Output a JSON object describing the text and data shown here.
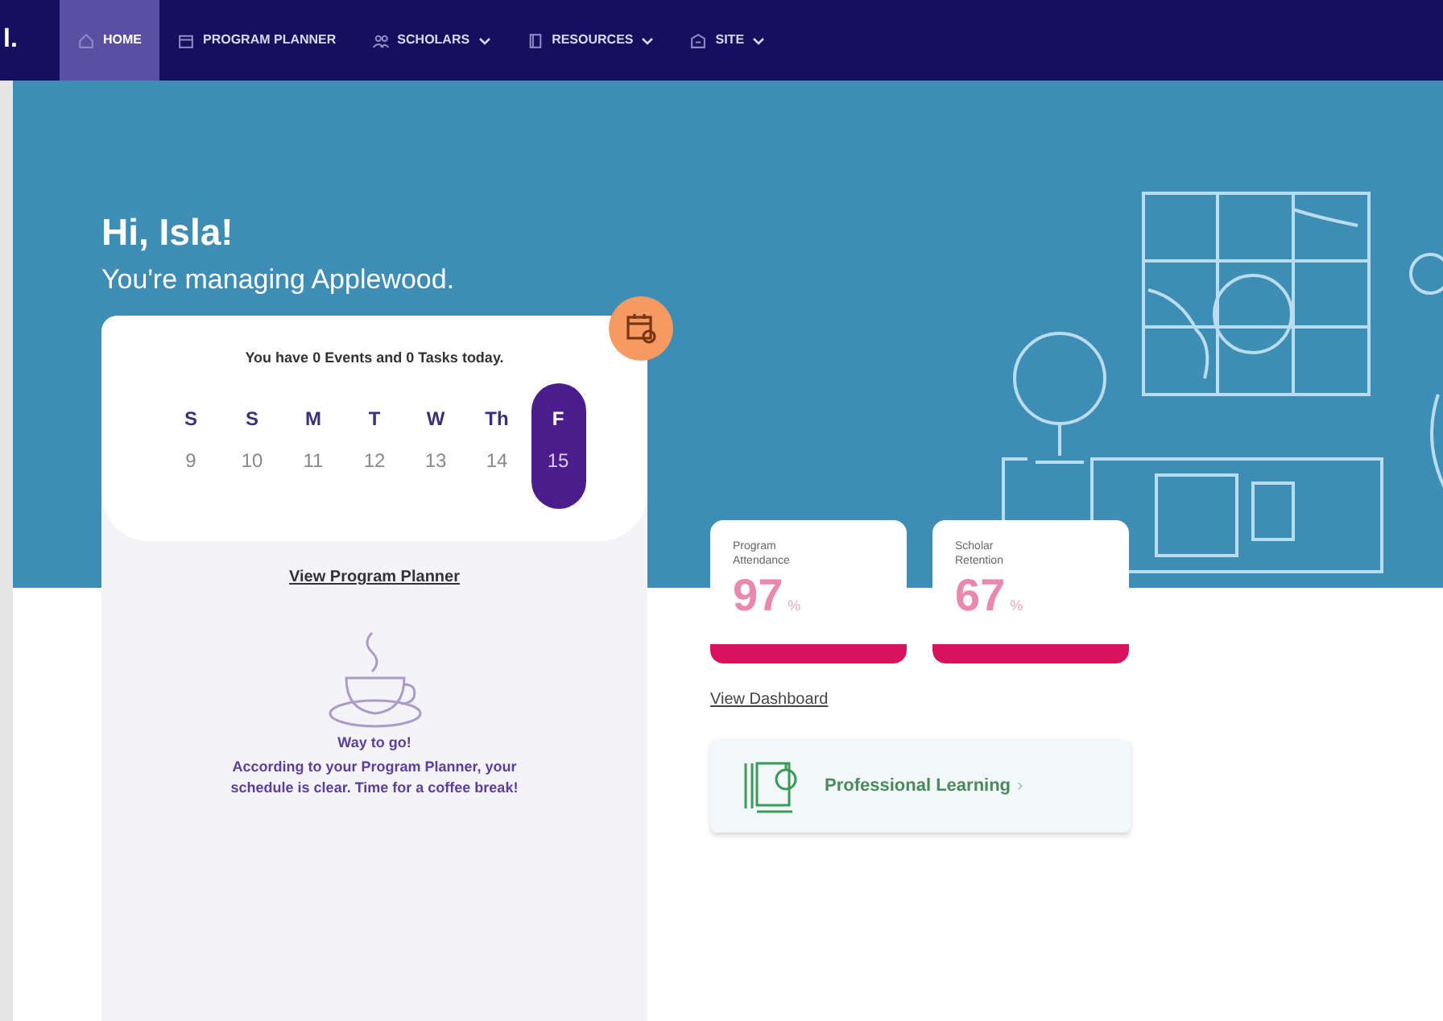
{
  "nav": {
    "logo": "l.",
    "items": [
      {
        "label": "HOME",
        "kind": "link",
        "selected": true
      },
      {
        "label": "PROGRAM PLANNER",
        "kind": "link",
        "selected": false
      },
      {
        "label": "SCHOLARS",
        "kind": "menu",
        "selected": false
      },
      {
        "label": "RESOURCES",
        "kind": "menu",
        "selected": false
      },
      {
        "label": "SITE",
        "kind": "menu",
        "selected": false
      }
    ]
  },
  "greeting": {
    "title": "Hi, Isla!",
    "subtitle": "You're managing Applewood."
  },
  "planner_card": {
    "summary": "You have 0 Events and 0 Tasks today.",
    "days": [
      {
        "day": "S",
        "date": "9",
        "selected": false
      },
      {
        "day": "S",
        "date": "10",
        "selected": false
      },
      {
        "day": "M",
        "date": "11",
        "selected": false
      },
      {
        "day": "T",
        "date": "12",
        "selected": false
      },
      {
        "day": "W",
        "date": "13",
        "selected": false
      },
      {
        "day": "Th",
        "date": "14",
        "selected": false
      },
      {
        "day": "F",
        "date": "15",
        "selected": true
      }
    ],
    "link": "View Program Planner",
    "empty_title": "Way to go!",
    "empty_message": "According to your Program Planner, your schedule is clear. Time for a coffee break!"
  },
  "stats": [
    {
      "label": "Program Attendance",
      "value": "97",
      "unit": "%"
    },
    {
      "label": "Scholar Retention",
      "value": "67",
      "unit": "%"
    }
  ],
  "dashboard_link": "View Dashboard",
  "learning_card": {
    "label": "Professional Learning",
    "arrow": "›"
  }
}
